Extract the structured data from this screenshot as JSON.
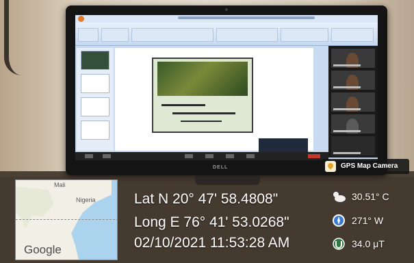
{
  "gps_badge": {
    "label": "GPS Map Camera",
    "icon": "map-pin-icon"
  },
  "map": {
    "labels": {
      "country_1": "Mali",
      "country_2": "Nigeria"
    },
    "provider": "Google",
    "colors": {
      "water": "#abd3ee",
      "land": "#f1efe6"
    }
  },
  "location": {
    "latitude": "Lat N 20° 47' 58.4808\"",
    "longitude": "Long E 76° 41' 53.0268\"",
    "datetime": "02/10/2021 11:53:28 AM"
  },
  "metrics": [
    {
      "icon": "weather-cloud-icon",
      "value": "30.51° C"
    },
    {
      "icon": "compass-icon",
      "value": "271° W"
    },
    {
      "icon": "magnet-icon",
      "value": "34.0 μT"
    }
  ],
  "monitor": {
    "brand": "DELL"
  }
}
